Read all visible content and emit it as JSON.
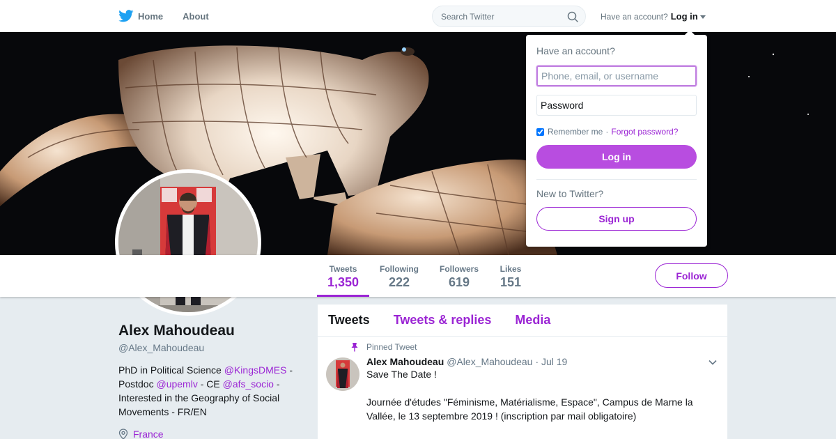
{
  "nav": {
    "home_label": "Home",
    "about_label": "About",
    "search_placeholder": "Search Twitter",
    "have_account": "Have an account?",
    "login_label": "Log in"
  },
  "profile": {
    "name": "Alex Mahoudeau",
    "handle": "@Alex_Mahoudeau",
    "bio": {
      "t1": "PhD in Political Science ",
      "m1": "@KingsDMES",
      "t2": " - Postdoc ",
      "m2": "@upemlv",
      "t3": " - CE ",
      "m3": "@afs_socio",
      "t4": " - Interested in the Geography of Social Movements - FR/EN"
    },
    "location": "France",
    "follow_label": "Follow"
  },
  "stats": [
    {
      "label": "Tweets",
      "value": "1,350"
    },
    {
      "label": "Following",
      "value": "222"
    },
    {
      "label": "Followers",
      "value": "619"
    },
    {
      "label": "Likes",
      "value": "151"
    }
  ],
  "tabs": [
    "Tweets",
    "Tweets & replies",
    "Media"
  ],
  "tweet": {
    "pinned_label": "Pinned Tweet",
    "name": "Alex Mahoudeau",
    "handle": "@Alex_Mahoudeau",
    "time": "· Jul 19",
    "line1": "Save The Date !",
    "line2": "Journée d'études \"Féminisme, Matérialisme, Espace\", Campus de Marne la Vallée, le 13 septembre 2019 ! (inscription par mail obligatoire)"
  },
  "login_dropdown": {
    "title": "Have an account?",
    "username_placeholder": "Phone, email, or username",
    "password_placeholder": "Password",
    "remember": "Remember me",
    "separator": "·",
    "forgot": "Forgot password?",
    "login_button": "Log in",
    "new_label": "New to Twitter?",
    "signup_button": "Sign up"
  },
  "colors": {
    "accent": "#9b25d4",
    "twitter_blue": "#1da1f2",
    "text_secondary": "#657786"
  }
}
